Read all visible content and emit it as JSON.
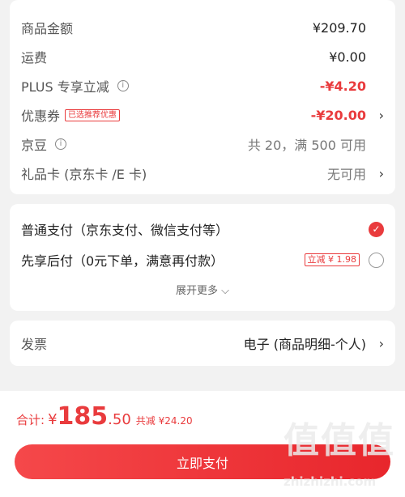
{
  "summary": {
    "goods_amount": {
      "label": "商品金额",
      "value": "¥209.70"
    },
    "shipping": {
      "label": "运费",
      "value": "¥0.00"
    },
    "plus": {
      "label": "PLUS 专享立减",
      "info_icon": "i",
      "value": "-¥4.20"
    },
    "coupon": {
      "label": "优惠券",
      "tag": "已选推荐优惠",
      "value": "-¥20.00",
      "chevron": "›"
    },
    "jd_bean": {
      "label": "京豆",
      "info_icon": "i",
      "value": "共 20，满 500 可用"
    },
    "gift_card": {
      "label": "礼品卡 (京东卡 /E 卡)",
      "value": "无可用",
      "chevron": "›"
    }
  },
  "payment": {
    "normal": {
      "label": "普通支付（京东支付、微信支付等）",
      "checked_glyph": "✓"
    },
    "later": {
      "label": "先享后付（0元下单，满意再付款）",
      "discount": "立减 ¥ 1.98"
    },
    "expand": "展开更多 ⌵"
  },
  "invoice": {
    "label": "发票",
    "value": "电子 (商品明细-个人)",
    "chevron": "›"
  },
  "total": {
    "label": "合计:",
    "currency": "¥",
    "integer": "185",
    "decimal": ".50",
    "savings": "共减 ¥24.20"
  },
  "pay_button": "立即支付",
  "watermark": {
    "chars": "值值值",
    "url": "zhizhizhi.com"
  },
  "colors": {
    "accent": "#e93b3d",
    "background": "#f2f2f2"
  }
}
